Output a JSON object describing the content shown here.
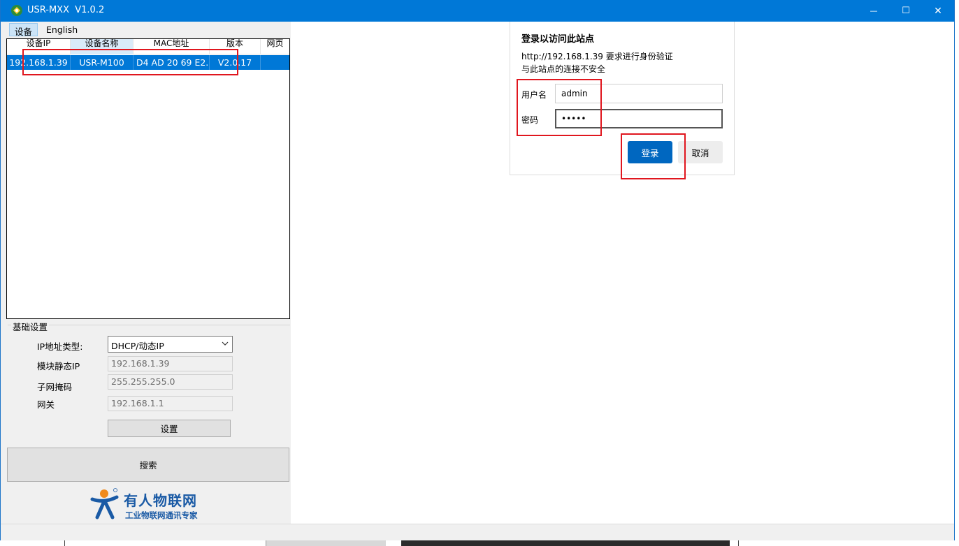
{
  "window": {
    "title": "USR-MXX  V1.0.2",
    "controls": {
      "minimize": "—",
      "maximize": "☐",
      "close": "✕"
    }
  },
  "menu": {
    "items": [
      "设备",
      "English"
    ]
  },
  "device_table": {
    "columns": [
      "设备IP",
      "设备名称",
      "MAC地址",
      "版本",
      "网页"
    ],
    "rows": [
      {
        "ip": "192.168.1.39",
        "name": "USR-M100",
        "mac": "D4 AD 20 69 E2...",
        "version": "V2.0.17",
        "web": ""
      }
    ]
  },
  "basic_settings": {
    "group_title": "基础设置",
    "ip_type_label": "IP地址类型:",
    "ip_type_value": "DHCP/动态IP",
    "static_ip_label": "模块静态IP",
    "static_ip_value": "192.168.1.39",
    "subnet_label": "子网掩码",
    "subnet_value": "255.255.255.0",
    "gateway_label": "网关",
    "gateway_value": "192.168.1.1",
    "set_button": "设置"
  },
  "search_button": "搜索",
  "brand": {
    "name": "有人物联网",
    "slogan": "工业物联网通讯专家"
  },
  "login_dialog": {
    "title": "登录以访问此站点",
    "message_line1": "http://192.168.1.39 要求进行身份验证",
    "message_line2": "与此站点的连接不安全",
    "username_label": "用户名",
    "username_value": "admin",
    "password_label": "密码",
    "password_value": "•••••",
    "login_button": "登录",
    "cancel_button": "取消"
  },
  "colors": {
    "titlebar": "#0078d7",
    "selection": "#0078d7",
    "login_button": "#0067c0",
    "highlight_box": "#e0161e",
    "brand": "#1a5aa5"
  }
}
